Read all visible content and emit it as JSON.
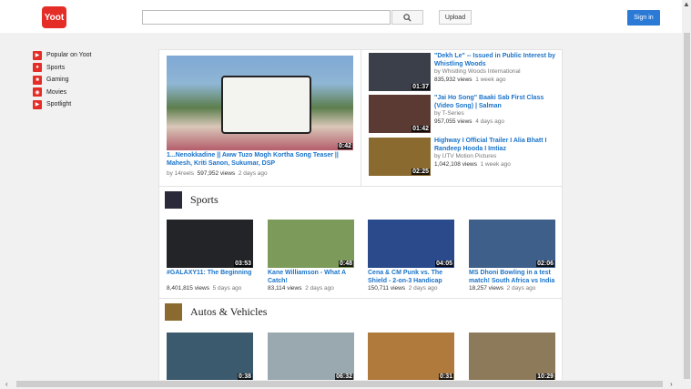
{
  "header": {
    "logo": "Yoot",
    "search_placeholder": "",
    "upload_label": "Upload",
    "signin_label": "Sign in"
  },
  "sidebar": {
    "items": [
      {
        "label": "Popular on Yoot",
        "icon": "popular-icon"
      },
      {
        "label": "Sports",
        "icon": "sports-icon"
      },
      {
        "label": "Gaming",
        "icon": "gaming-icon"
      },
      {
        "label": "Movies",
        "icon": "movies-icon"
      },
      {
        "label": "Spotlight",
        "icon": "spotlight-icon"
      }
    ]
  },
  "featured": {
    "duration": "0:42",
    "title": "1...Nenokkadine || Aww Tuzo Mogh Kortha Song Teaser || Mahesh, Kriti Sanon, Sukumar, DSP",
    "channel": "by 14reels",
    "views": "597,952 views",
    "age": "2 days ago"
  },
  "side_videos": [
    {
      "duration": "01:37",
      "title": "\"Dekh Le\" -- Issued in Public Interest by Whistling Woods",
      "channel": "by Whistling Woods International",
      "views": "835,932 views",
      "age": "1 week ago",
      "thumb": "#3a3f4a"
    },
    {
      "duration": "01:42",
      "title": "\"Jai Ho Song\" Baaki Sab First Class (Video Song) | Salman",
      "channel": "by T-Series",
      "views": "957,055 views",
      "age": "4 days ago",
      "thumb": "#5b3a33"
    },
    {
      "duration": "02:25",
      "title": "Highway I Official Trailer I Alia Bhatt I Randeep Hooda I Imtiaz",
      "channel": "by UTV Motion Pictures",
      "views": "1,042,108 views",
      "age": "1 week ago",
      "thumb": "#8a6a2e"
    }
  ],
  "sections": [
    {
      "title": "Sports",
      "videos": [
        {
          "duration": "03:53",
          "title": "#GALAXY11: The Beginning",
          "views": "8,401,815 views",
          "age": "5 days ago",
          "thumb": "#222428"
        },
        {
          "duration": "0:48",
          "title": "Kane Williamson - What A Catch!",
          "views": "83,114 views",
          "age": "2 days ago",
          "thumb": "#7c9a5a"
        },
        {
          "duration": "04:05",
          "title": "Cena & CM Punk vs. The Shield - 2-on-3 Handicap",
          "views": "150,711 views",
          "age": "2 days ago",
          "thumb": "#2a4a8c"
        },
        {
          "duration": "02:06",
          "title": "MS Dhoni Bowling in a test match! South Africa vs India",
          "views": "18,257 views",
          "age": "2 days ago",
          "thumb": "#3d5f8a"
        }
      ]
    },
    {
      "title": "Autos & Vehicles",
      "videos": [
        {
          "duration": "0:38",
          "title": "",
          "views": "",
          "age": "",
          "thumb": "#3c5a6e"
        },
        {
          "duration": "06:32",
          "title": "",
          "views": "",
          "age": "",
          "thumb": "#9aa8b0"
        },
        {
          "duration": "0:31",
          "title": "",
          "views": "",
          "age": "",
          "thumb": "#b07a3c"
        },
        {
          "duration": "10:29",
          "title": "",
          "views": "",
          "age": "",
          "thumb": "#8c7a5a"
        }
      ]
    }
  ],
  "colors": {
    "brand": "#e52d27",
    "link": "#1a73c9",
    "signin": "#2b7bd6"
  }
}
